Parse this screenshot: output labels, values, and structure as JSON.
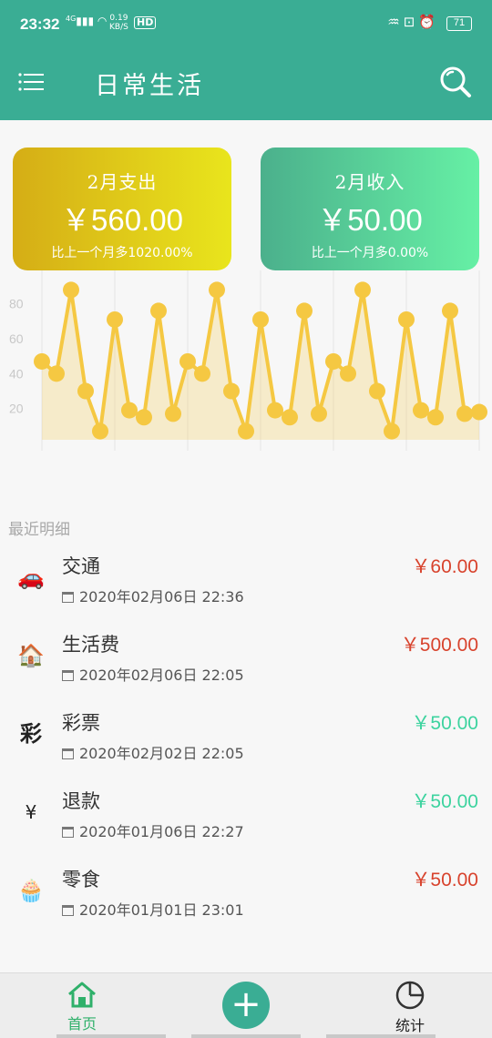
{
  "status_bar": {
    "time": "23:32",
    "signal": "4G",
    "net_speed_value": "0.19",
    "net_speed_unit": "KB/S",
    "hd": "HD",
    "battery": "71"
  },
  "app_bar": {
    "title": "日常生活"
  },
  "summary": {
    "expense": {
      "label": "2月支出",
      "amount": "￥560.00",
      "compare": "比上一个月多1020.00%"
    },
    "income": {
      "label": "2月收入",
      "amount": "￥50.00",
      "compare": "比上一个月多0.00%"
    }
  },
  "chart_data": {
    "type": "area",
    "y_ticks": [
      "20",
      "40",
      "60",
      "80"
    ],
    "ylim": [
      0,
      95
    ],
    "grid": true,
    "color": "#f5c842",
    "values": [
      47,
      40,
      88,
      30,
      7,
      71,
      19,
      15,
      76,
      17,
      47,
      40,
      88,
      30,
      7,
      71,
      19,
      15,
      76,
      17,
      47,
      40,
      88,
      30,
      7,
      71,
      19,
      15,
      76,
      17,
      18
    ]
  },
  "recent": {
    "title": "最近明细",
    "items": [
      {
        "icon": "car-icon",
        "name": "交通",
        "date": "2020年02月06日  22:36",
        "amount": "￥60.00",
        "kind": "out"
      },
      {
        "icon": "house-yen-icon",
        "name": "生活费",
        "date": "2020年02月06日  22:05",
        "amount": "￥500.00",
        "kind": "out"
      },
      {
        "icon": "lottery-icon",
        "name": "彩票",
        "date": "2020年02月02日  22:05",
        "amount": "￥50.00",
        "kind": "in"
      },
      {
        "icon": "refund-icon",
        "name": "退款",
        "date": "2020年01月06日  22:27",
        "amount": "￥50.00",
        "kind": "in"
      },
      {
        "icon": "snack-icon",
        "name": "零食",
        "date": "2020年01月01日  23:01",
        "amount": "￥50.00",
        "kind": "out"
      }
    ]
  },
  "bottom_nav": {
    "home": "首页",
    "stats": "统计"
  },
  "colors": {
    "primary": "#3aad94",
    "expense": "#d8432d",
    "income": "#3dd39f",
    "chart": "#f5c842"
  }
}
